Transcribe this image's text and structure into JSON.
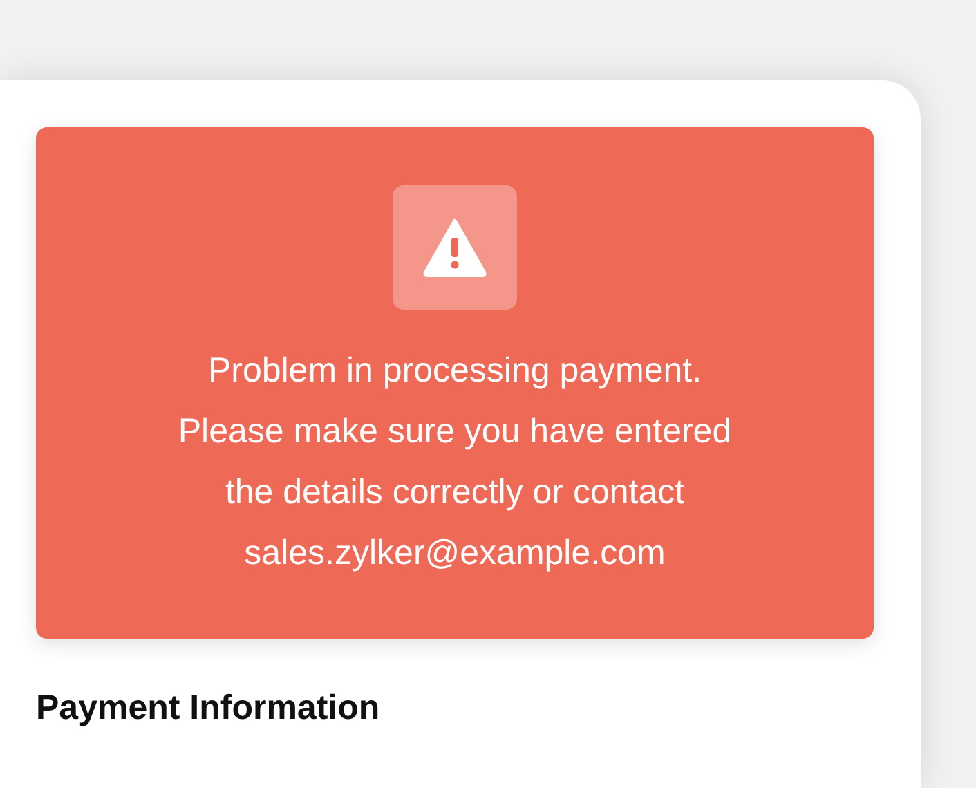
{
  "alert": {
    "kind": "error",
    "message": "Problem in processing payment. Please make sure you have entered the details correctly or contact sales.zylker@example.com"
  },
  "section": {
    "title": "Payment Information"
  }
}
